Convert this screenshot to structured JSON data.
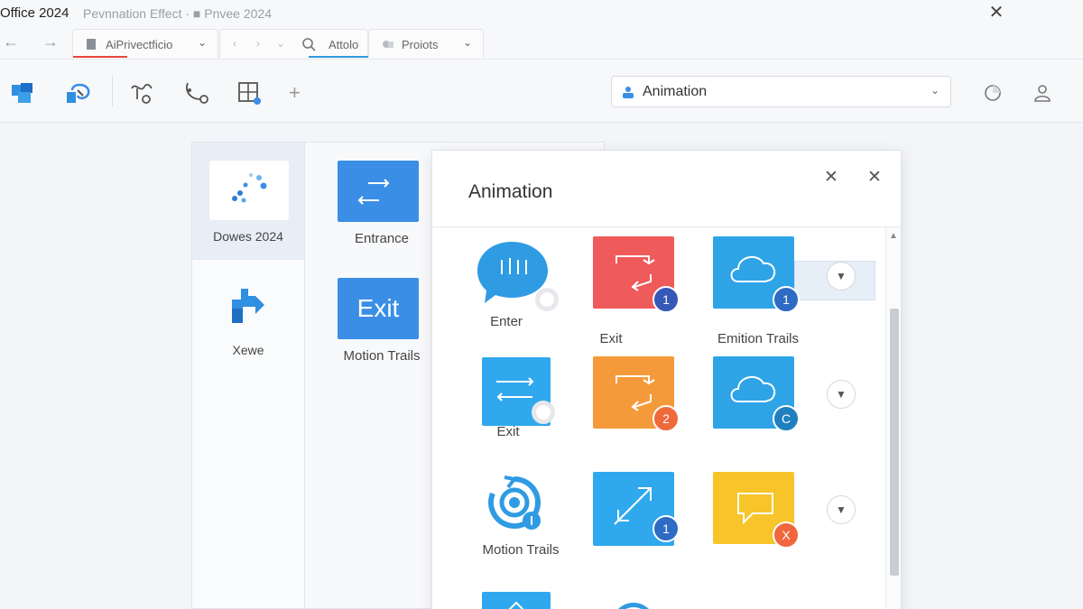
{
  "window": {
    "app_title": "Office 2024",
    "doc_title": "Pevnnation Effect ·  ■  Pnvee 2024",
    "close_icon": "close-icon"
  },
  "nav": {
    "back_icon": "arrow-left-icon",
    "forward_icon": "arrow-right-icon",
    "tabs": [
      {
        "label": "AiPrivectficio",
        "icon": "document-icon"
      },
      {
        "label": "Attolo",
        "icon": "search-icon"
      },
      {
        "label": "Proiots",
        "icon": "shape-icon"
      }
    ]
  },
  "ribbon": {
    "tools": [
      "layout-icon",
      "transition-icon",
      "path-icon",
      "motion-icon",
      "grid-icon",
      "add-icon"
    ],
    "animation_select": {
      "value": "Animation",
      "icon": "person-icon"
    },
    "timer_icon": "timer-icon",
    "user_icon": "user-icon"
  },
  "left_panel": {
    "items": [
      {
        "label": "Dowes 2024"
      },
      {
        "label": "Xewe"
      }
    ]
  },
  "mid_panel": {
    "items": [
      {
        "label": "Entrance",
        "tile_text": ""
      },
      {
        "label": "Motion Trails",
        "tile_text": "Exit"
      }
    ]
  },
  "dialog": {
    "title": "Animation",
    "rows": [
      [
        {
          "label": "Enter",
          "icon": "speech-bubble-icon",
          "color": "#2f9be3"
        },
        {
          "label": "Exit",
          "icon": "swap-arrows-icon",
          "color": "#ef5a5a",
          "badge": "1",
          "badge_color": "#3658b7"
        },
        {
          "label": "Emition Trails",
          "icon": "cloud-icon",
          "color": "#2ea3e6",
          "badge": "1",
          "badge_color": "#2d6bc4"
        }
      ],
      [
        {
          "label": "Exit",
          "icon": "arrows-icon",
          "color": "#2fa8ee"
        },
        {
          "label": "",
          "icon": "swap-arrows-icon",
          "color": "#f59a3a",
          "badge": "2",
          "badge_color": "#ef6a3b"
        },
        {
          "label": "",
          "icon": "cloud-icon",
          "color": "#2ea3e6",
          "badge": "C",
          "badge_color": "#1f7fbf"
        }
      ],
      [
        {
          "label": "Motion Trails",
          "icon": "target-icon",
          "color": "#2f9be3"
        },
        {
          "label": "",
          "icon": "diagonal-arrow-icon",
          "color": "#2fa8ee",
          "badge": "1",
          "badge_color": "#2d6bc4"
        },
        {
          "label": "",
          "icon": "message-box-icon",
          "color": "#f7c52a",
          "badge": "X",
          "badge_color": "#f0663d"
        }
      ]
    ],
    "colors": {
      "accent": "#2f9be3",
      "red_underline": "#e8453c",
      "blue_underline": "#2f9be3"
    }
  }
}
